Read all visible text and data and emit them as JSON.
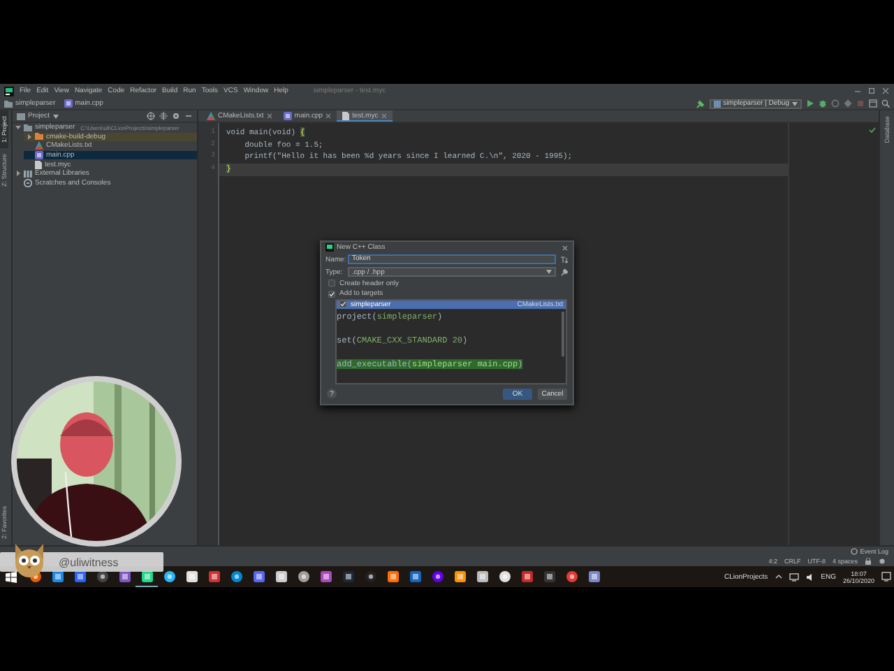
{
  "window": {
    "title": "simpleparser - test.myc",
    "menu": [
      "File",
      "Edit",
      "View",
      "Navigate",
      "Code",
      "Refactor",
      "Build",
      "Run",
      "Tools",
      "VCS",
      "Window",
      "Help"
    ]
  },
  "navbar": {
    "crumbs": [
      {
        "label": "simpleparser",
        "kind": "project"
      },
      {
        "label": "main.cpp",
        "kind": "cpp"
      }
    ],
    "run_config": "simpleparser | Debug"
  },
  "side_tabs": {
    "left": [
      {
        "label": "1: Project",
        "selected": true
      },
      {
        "label": "Z: Structure",
        "selected": false
      }
    ],
    "left_bottom": [
      {
        "label": "2: Favorites",
        "selected": false
      }
    ],
    "right": [
      {
        "label": "Database",
        "selected": false
      }
    ]
  },
  "project": {
    "title": "Project",
    "tree": [
      {
        "label": "simpleparser",
        "path": "C:\\Users\\uli\\CLionProjects\\simpleparser",
        "kind": "folder",
        "expanded": true,
        "selected": false,
        "children": [
          {
            "label": "cmake-build-debug",
            "kind": "excluded",
            "expanded": false,
            "selected": false
          },
          {
            "label": "CMakeLists.txt",
            "kind": "cmake",
            "selected": false
          },
          {
            "label": "main.cpp",
            "kind": "cpp",
            "selected": true
          },
          {
            "label": "test.myc",
            "kind": "file",
            "selected": false
          }
        ]
      },
      {
        "label": "External Libraries",
        "kind": "library",
        "expanded": false,
        "selected": false
      },
      {
        "label": "Scratches and Consoles",
        "kind": "scratch",
        "selected": false
      }
    ]
  },
  "editor": {
    "tabs": [
      {
        "label": "CMakeLists.txt",
        "kind": "cmake",
        "selected": false
      },
      {
        "label": "main.cpp",
        "kind": "cpp",
        "selected": false
      },
      {
        "label": "test.myc",
        "kind": "file",
        "selected": true
      }
    ],
    "lines": [
      {
        "number": "1",
        "current": false,
        "tokens": [
          {
            "text": "void main(void) ",
            "kind": "plain"
          },
          {
            "text": "{",
            "kind": "match"
          }
        ]
      },
      {
        "number": "2",
        "current": false,
        "tokens": [
          {
            "text": "    double foo = 1.5;",
            "kind": "plain"
          }
        ]
      },
      {
        "number": "3",
        "current": false,
        "tokens": [
          {
            "text": "    printf(\"Hello it has been %d years since I learned C.\\n\", 2020 - 1995);",
            "kind": "plain"
          }
        ]
      },
      {
        "number": "4",
        "current": true,
        "tokens": [
          {
            "text": "}",
            "kind": "match"
          }
        ]
      }
    ]
  },
  "dialog": {
    "title": "New C++ Class",
    "name_label": "Name:",
    "name_value": "Token",
    "type_label": "Type:",
    "type_value": ".cpp / .hpp",
    "options": [
      {
        "label": "Create header only",
        "checked": false
      },
      {
        "label": "Add to targets",
        "checked": true
      }
    ],
    "targets": [
      {
        "label": "simpleparser",
        "file": "CMakeLists.txt",
        "checked": true,
        "selected": true
      }
    ],
    "preview": [
      {
        "highlighted": false,
        "tokens": [
          {
            "text": "project(",
            "kind": "func"
          },
          {
            "text": "simpleparser",
            "kind": "arg"
          },
          {
            "text": ")",
            "kind": "func"
          }
        ]
      },
      {
        "highlighted": false,
        "tokens": [
          {
            "text": "set(",
            "kind": "func"
          },
          {
            "text": "CMAKE_CXX_STANDARD 20",
            "kind": "arg"
          },
          {
            "text": ")",
            "kind": "func"
          }
        ]
      },
      {
        "highlighted": true,
        "tokens": [
          {
            "text": "add_executable(",
            "kind": "func"
          },
          {
            "text": "simpleparser main.cpp",
            "kind": "arg"
          },
          {
            "text": ")",
            "kind": "func"
          }
        ]
      }
    ],
    "help": "?",
    "buttons": [
      {
        "label": "OK",
        "kind": "primary"
      },
      {
        "label": "Cancel",
        "kind": "secondary"
      }
    ]
  },
  "status_bar": {
    "event_log": "Event Log",
    "items": [
      "4:2",
      "CRLF",
      "UTF-8",
      "4 spaces"
    ]
  },
  "taskbar": {
    "folder_label": "CLionProjects",
    "language": "ENG",
    "time": "18:07",
    "date": "26/10/2020"
  },
  "stream_overlay": {
    "handle": "@uliwitness"
  }
}
